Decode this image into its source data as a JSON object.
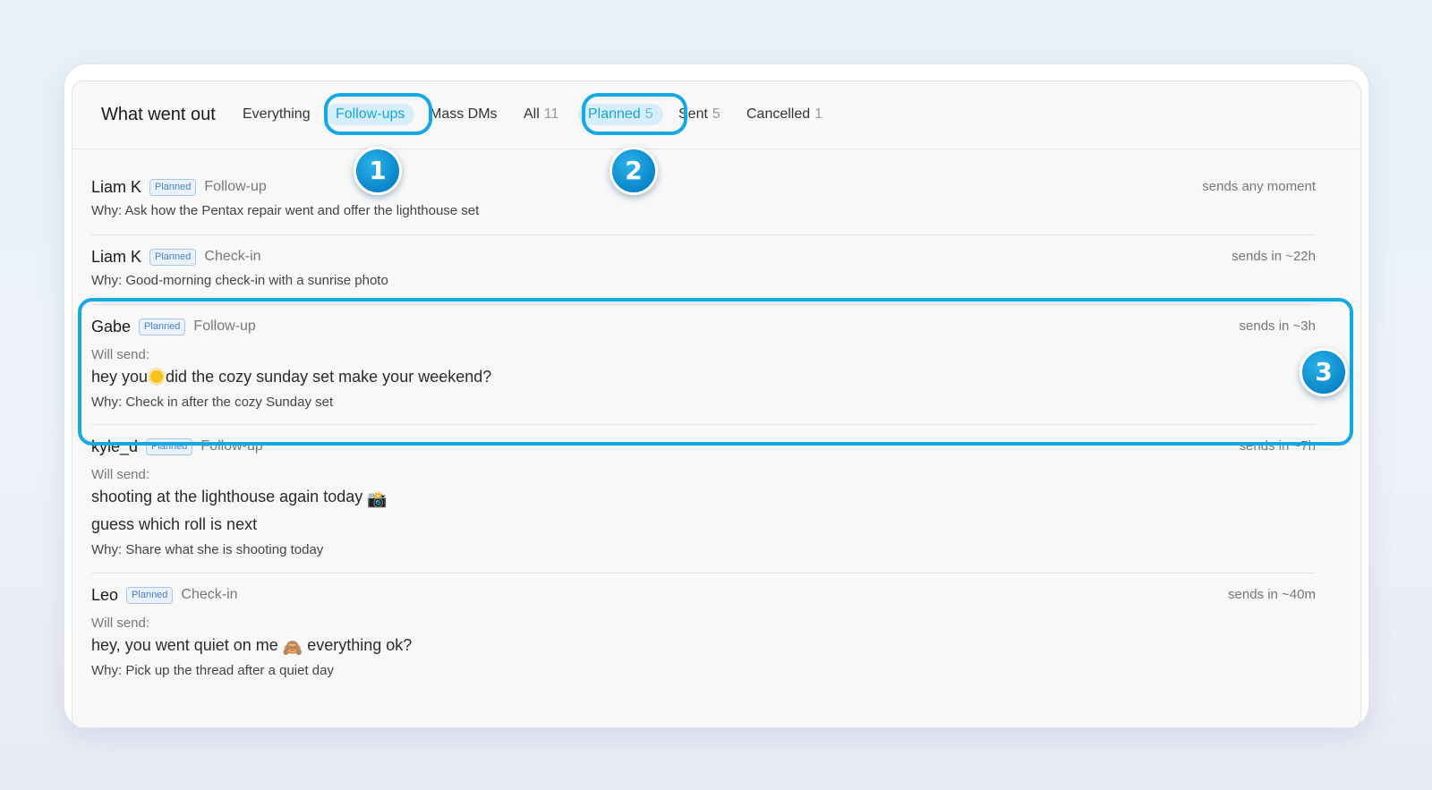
{
  "header": {
    "title": "What went out",
    "tabs": [
      {
        "label": "Everything"
      },
      {
        "label": "Follow-ups"
      },
      {
        "label": "Mass DMs"
      }
    ],
    "filters": [
      {
        "label": "All",
        "count": "11"
      },
      {
        "label": "Planned",
        "count": "5"
      },
      {
        "label": "Sent",
        "count": "5"
      },
      {
        "label": "Cancelled",
        "count": "1"
      }
    ]
  },
  "callouts": [
    "1",
    "2",
    "3"
  ],
  "will_send_label": "Will send:",
  "items": [
    {
      "name": "Liam K",
      "status": "Planned",
      "type": "Follow-up",
      "when": "sends any moment",
      "why": "Why: Ask how the Pentax repair went and offer the lighthouse set"
    },
    {
      "name": "Liam K",
      "status": "Planned",
      "type": "Check-in",
      "when": "sends in ~22h",
      "why": "Why: Good-morning check-in with a sunrise photo"
    },
    {
      "name": "Gabe",
      "status": "Planned",
      "type": "Follow-up",
      "when": "sends in ~3h",
      "message_pre": "hey you",
      "message_post": "did the cozy sunday set make your weekend?",
      "why": "Why: Check in after the cozy Sunday set"
    },
    {
      "name": "kyle_d",
      "status": "Planned",
      "type": "Follow-up",
      "when": "sends in ~7h",
      "message_line1": "shooting at the lighthouse again today",
      "message_line1_emoji": "📸",
      "message_line2": "guess which roll is next",
      "why": "Why: Share what she is shooting today"
    },
    {
      "name": "Leo",
      "status": "Planned",
      "type": "Check-in",
      "when": "sends in ~40m",
      "message_pre": "hey, you went quiet on me",
      "message_emoji": "🙈",
      "message_post": "everything ok?",
      "why": "Why: Pick up the thread after a quiet day"
    }
  ]
}
